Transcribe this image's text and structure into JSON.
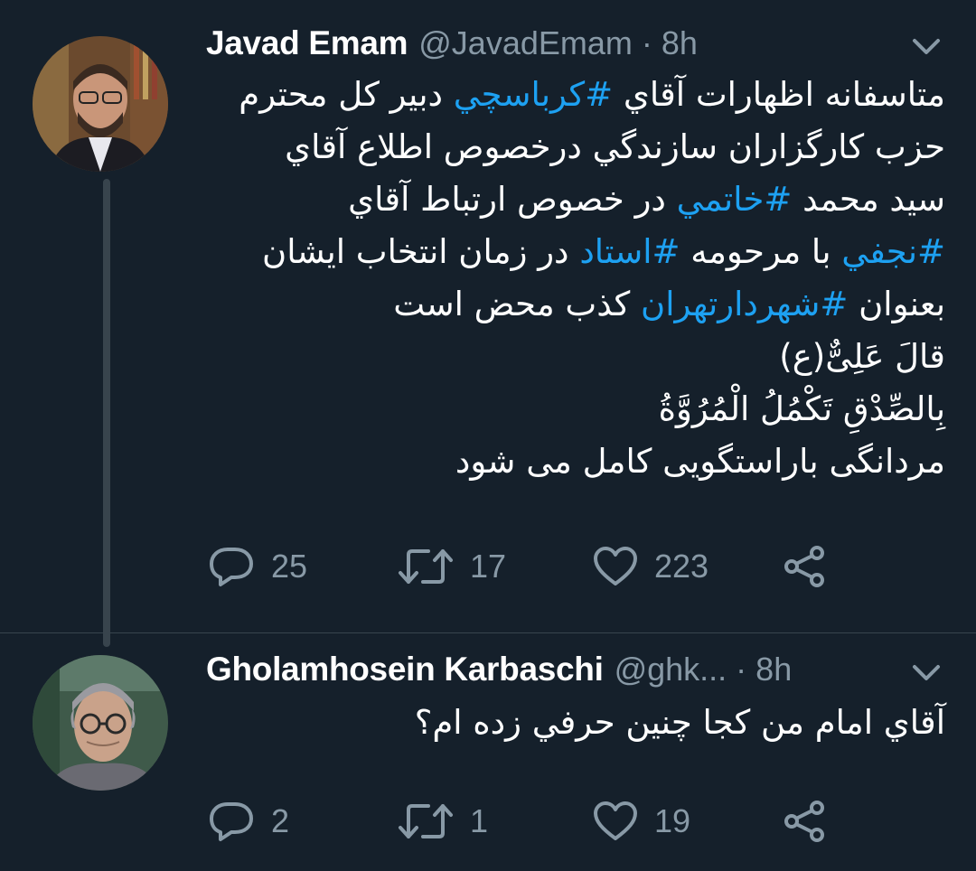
{
  "tweets": [
    {
      "author_name": "Javad Emam",
      "handle": "@JavadEmam",
      "separator": "·",
      "time": "8h",
      "lines": [
        [
          {
            "t": "متاسفانه اظهارات آقاي "
          },
          {
            "t": "#كرباسچي",
            "tag": true
          },
          {
            "t": " دبير كل محترم"
          }
        ],
        [
          {
            "t": "حزب كارگزاران سازندگي درخصوص اطلاع آقاي"
          }
        ],
        [
          {
            "t": "سيد محمد "
          },
          {
            "t": "#خاتمي",
            "tag": true
          },
          {
            "t": " در خصوص ارتباط آقاي"
          }
        ],
        [
          {
            "t": "#نجفي",
            "tag": true
          },
          {
            "t": " با مرحومه "
          },
          {
            "t": "#استاد",
            "tag": true
          },
          {
            "t": " در زمان انتخاب ايشان"
          }
        ],
        [
          {
            "t": "بعنوان "
          },
          {
            "t": "#شهردارتهران",
            "tag": true
          },
          {
            "t": " كذب محض است"
          }
        ],
        [
          {
            "t": " قالَ عَلِیٌّ(ع)"
          }
        ],
        [
          {
            "t": "بِالصِّدْقِ تَكْمُلُ الْمُرُوَّةُ"
          }
        ],
        [
          {
            "t": "مردانگی باراستگویی کامل می شود"
          }
        ]
      ],
      "replies": "25",
      "retweets": "17",
      "likes": "223"
    },
    {
      "author_name": "Gholamhosein Karbaschi",
      "handle": "@ghk...",
      "separator": "·",
      "time": "8h",
      "lines": [
        [
          {
            "t": "آقاي امام من كجا چنين حرفي زده ام؟"
          }
        ]
      ],
      "replies": "2",
      "retweets": "1",
      "likes": "19"
    }
  ],
  "icons": {
    "reply": "reply-icon",
    "retweet": "retweet-icon",
    "like": "heart-icon",
    "share": "share-icon",
    "menu": "chevron-down-icon"
  },
  "colors": {
    "background": "#15202b",
    "text": "#ffffff",
    "muted": "#8899a6",
    "hashtag": "#1da1f2",
    "thread_line": "#38444d"
  }
}
